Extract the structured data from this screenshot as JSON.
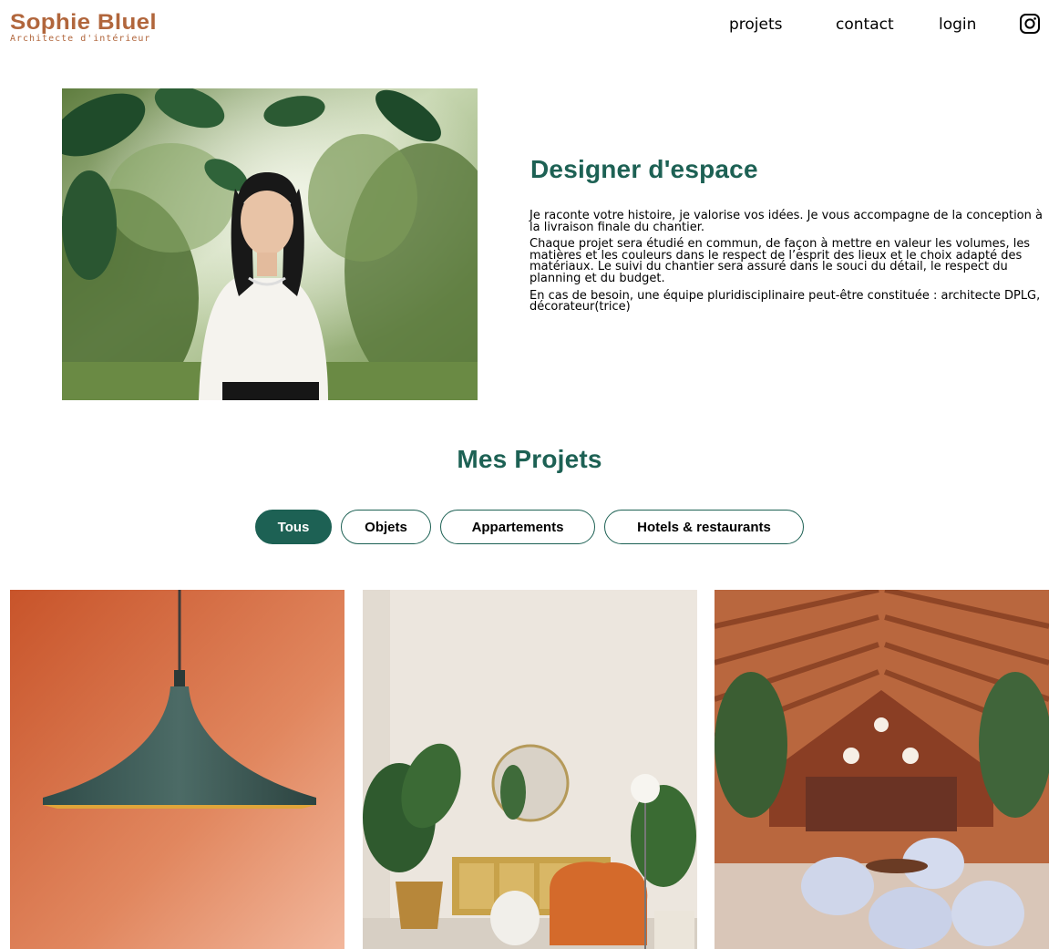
{
  "header": {
    "logo_title": "Sophie Bluel",
    "logo_subtitle": "Architecte d'intérieur",
    "nav": {
      "projets": "projets",
      "contact": "contact",
      "login": "login"
    },
    "instagram_icon": "instagram-icon"
  },
  "intro": {
    "photo": "portrait-photo",
    "title": "Designer d'espace",
    "paragraphs": [
      "Je raconte votre histoire, je valorise vos idées. Je vous accompagne de la conception à la livraison finale du chantier.",
      "Chaque projet sera étudié en commun, de façon à mettre en valeur les volumes, les matières et les couleurs dans le respect de l’esprit des lieux et le choix adapté des matériaux. Le suivi du chantier sera assuré dans le souci du détail, le respect du planning et du budget.",
      "En cas de besoin, une équipe pluridisciplinaire peut-être constituée : architecte DPLG, décorateur(trice)"
    ]
  },
  "projects": {
    "title": "Mes Projets",
    "filters": [
      "Tous",
      "Objets",
      "Appartements",
      "Hotels & restaurants"
    ],
    "active_filter": "Tous",
    "gallery": [
      "pendant-lamp-photo",
      "living-room-photo",
      "restaurant-photo"
    ]
  },
  "colors": {
    "brand": "#B1663C",
    "accent": "#1D6154"
  }
}
